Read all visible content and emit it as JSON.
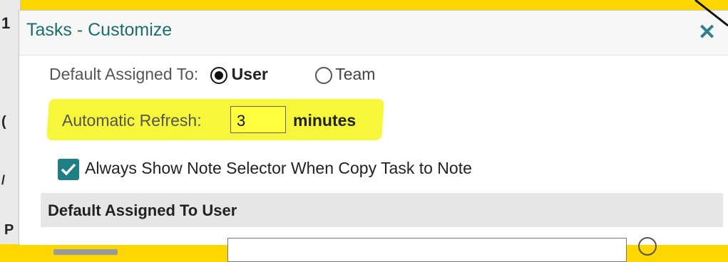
{
  "dialog": {
    "title": "Tasks - Customize",
    "close_icon": "close-icon"
  },
  "default_assigned": {
    "label": "Default Assigned To:",
    "options": [
      {
        "label": "User",
        "selected": true
      },
      {
        "label": "Team",
        "selected": false
      }
    ]
  },
  "refresh": {
    "label": "Automatic Refresh:",
    "value": "3",
    "unit": "minutes"
  },
  "note_selector": {
    "label": "Always Show Note Selector When Copy Task to Note",
    "checked": true
  },
  "section": {
    "title": "Default Assigned To User"
  },
  "colors": {
    "accent": "#1f7f86",
    "highlight": "#f6f73a",
    "frame": "#ffd700"
  }
}
